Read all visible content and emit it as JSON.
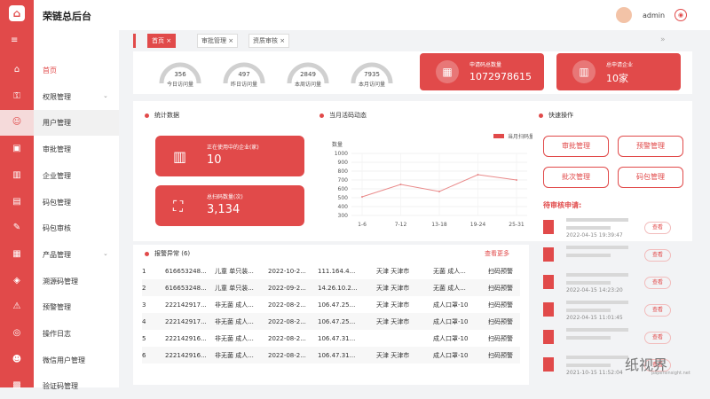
{
  "app": {
    "title": "荣链总后台",
    "user": "admin"
  },
  "sidebar": {
    "items": [
      {
        "label": "首页",
        "icon": "home-icon",
        "active": true
      },
      {
        "label": "权限管理",
        "icon": "user-lock-icon",
        "chevron": true
      },
      {
        "label": "用户管理",
        "icon": "user-icon",
        "hover": true
      },
      {
        "label": "审批管理",
        "icon": "approve-icon"
      },
      {
        "label": "企业管理",
        "icon": "building-icon"
      },
      {
        "label": "码包管理",
        "icon": "package-icon"
      },
      {
        "label": "码包审核",
        "icon": "audit-icon"
      },
      {
        "label": "产品管理",
        "icon": "grid-icon",
        "chevron": true
      },
      {
        "label": "溯源码管理",
        "icon": "trace-icon"
      },
      {
        "label": "预警管理",
        "icon": "alarm-icon"
      },
      {
        "label": "操作日志",
        "icon": "log-icon"
      },
      {
        "label": "微信用户管理",
        "icon": "wechat-user-icon"
      },
      {
        "label": "验证码管理",
        "icon": "code-icon"
      }
    ]
  },
  "tabs": [
    {
      "label": "首页",
      "active": true
    },
    {
      "label": "审批管理"
    },
    {
      "label": "资质审核"
    }
  ],
  "gauges": [
    {
      "value": "356",
      "label": "今日访问量"
    },
    {
      "value": "497",
      "label": "昨日访问量"
    },
    {
      "value": "2849",
      "label": "本周访问量"
    },
    {
      "value": "7935",
      "label": "本月访问量"
    }
  ],
  "stat_cards": [
    {
      "label": "申请码总数量",
      "value": "1072978615",
      "icon": "qr-icon"
    },
    {
      "label": "总申请企业",
      "value": "10家",
      "icon": "building-icon"
    }
  ],
  "stats": {
    "title": "统计数据",
    "cards": [
      {
        "label": "正在使用中的企业(家)",
        "value": "10"
      },
      {
        "label": "总扫码数量(次)",
        "value": "3,134"
      }
    ]
  },
  "scan_chart": {
    "title": "当月活码动态"
  },
  "chart_data": {
    "type": "line",
    "categories": [
      "1-6",
      "7-12",
      "13-18",
      "19-24",
      "25-31"
    ],
    "series": [
      {
        "name": "当月扫码量",
        "values": [
          510,
          650,
          570,
          760,
          700
        ]
      }
    ],
    "ylabel": "数量",
    "ylim": [
      300,
      1000
    ],
    "yticks": [
      300,
      400,
      500,
      600,
      700,
      800,
      900,
      1000
    ],
    "legend": "top-right",
    "grid": true
  },
  "quick": {
    "title": "快速操作",
    "buttons": [
      "审批管理",
      "预警管理",
      "批次管理",
      "码包管理"
    ]
  },
  "pending": {
    "title": "待审核申请:",
    "action": "查看",
    "dates": [
      "2022-04-15 19:39:47",
      "",
      "2022-04-15 14:23:20",
      "2022-04-15 11:01:45",
      "",
      "2021-10-15 11:52:04"
    ]
  },
  "alarm": {
    "title": "报警异常",
    "count": "(6)",
    "more": "查看更多",
    "rows": [
      [
        "1",
        "616653248...",
        "儿童 单只装...",
        "2022-10-2...",
        "111.164.4...",
        "天津 天津市",
        "无菌 成人...",
        "扫码预警"
      ],
      [
        "2",
        "616653248...",
        "儿童 单只装...",
        "2022-09-2...",
        "14.26.10.2...",
        "天津 天津市",
        "无菌 成人...",
        "扫码预警"
      ],
      [
        "3",
        "222142917...",
        "非无菌 成人...",
        "2022-08-2...",
        "106.47.25...",
        "天津 天津市",
        "成人口罩-10",
        "扫码预警"
      ],
      [
        "4",
        "222142917...",
        "非无菌 成人...",
        "2022-08-2...",
        "106.47.25...",
        "天津 天津市",
        "成人口罩-10",
        "扫码预警"
      ],
      [
        "5",
        "222142916...",
        "非无菌 成人...",
        "2022-08-2...",
        "106.47.31...",
        "",
        "成人口罩-10",
        "扫码预警"
      ],
      [
        "6",
        "222142916...",
        "非无菌 成人...",
        "2022-08-2...",
        "106.47.31...",
        "天津 天津市",
        "成人口罩-10",
        "扫码预警"
      ]
    ]
  },
  "watermark": {
    "text": "纸视界",
    "sub": "papersinsight.net"
  }
}
